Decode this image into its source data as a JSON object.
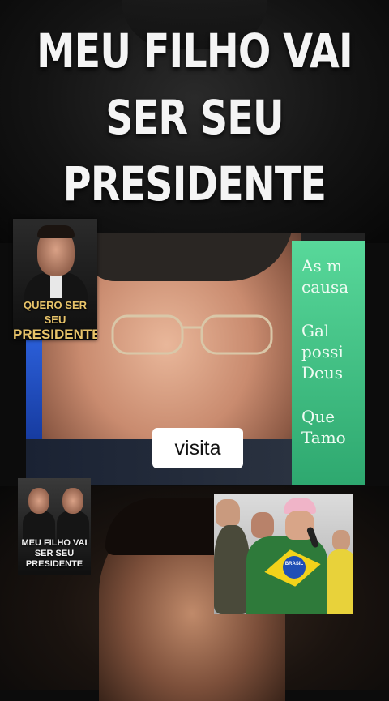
{
  "headline": {
    "line1": "MEU FILHO VAI",
    "line2": "SER SEU",
    "line3": "PRESIDENTE"
  },
  "video": {
    "panel_lines": [
      "As m",
      "causa",
      "Gal",
      "possi",
      "Deus",
      "Que",
      "Tamo"
    ],
    "caption": "visita"
  },
  "thumb1": {
    "line1": "QUERO SER SEU",
    "line2": "PRESIDENTE"
  },
  "thumb2": {
    "line1": "MEU FILHO VAI",
    "line2": "SER SEU",
    "line3": "PRESIDENTE"
  },
  "thumb3": {
    "globe_text": "BRASIL"
  }
}
